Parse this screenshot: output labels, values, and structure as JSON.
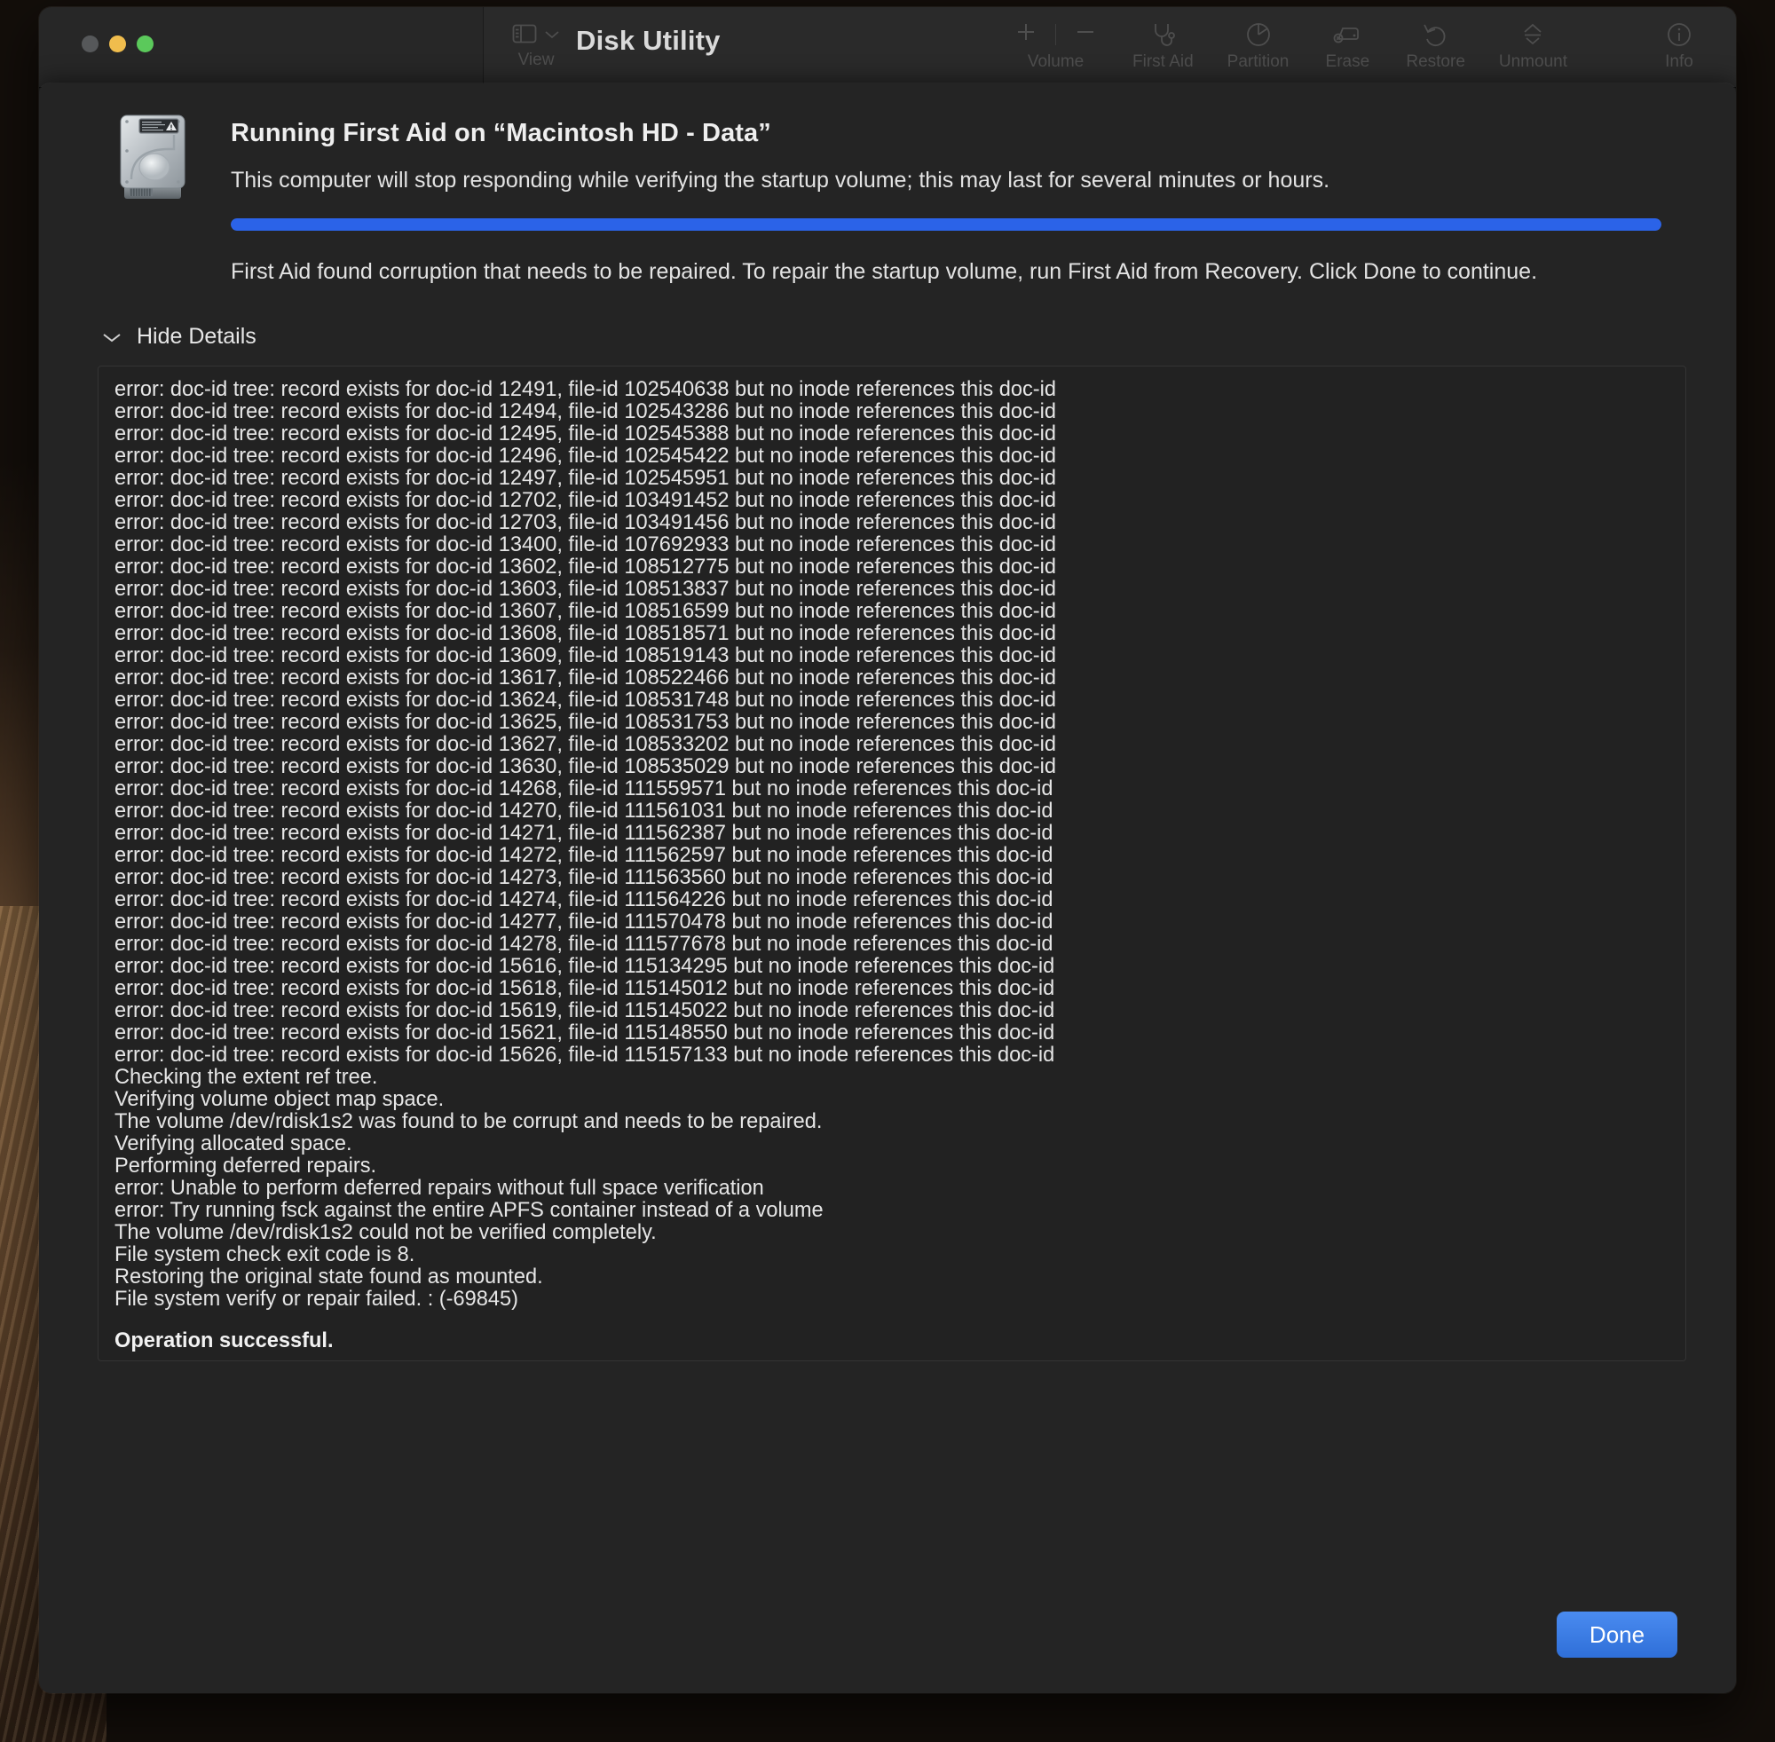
{
  "window": {
    "app_title": "Disk Utility",
    "traffic_lights": [
      "close-button",
      "minimize-button",
      "zoom-button"
    ],
    "sidebar_toggle_label": "View",
    "toolbar": [
      {
        "icon": "plus-icon",
        "label": ""
      },
      {
        "icon": "minus-icon",
        "label": "Volume"
      },
      {
        "icon": "stethoscope-icon",
        "label": "First Aid"
      },
      {
        "icon": "pie-chart-icon",
        "label": "Partition"
      },
      {
        "icon": "erase-disk-icon",
        "label": "Erase"
      },
      {
        "icon": "undo-arrow-icon",
        "label": "Restore"
      },
      {
        "icon": "eject-icon",
        "label": "Unmount"
      },
      {
        "icon": "info-circle-icon",
        "label": "Info"
      }
    ],
    "toolbar_labels": {
      "volume": "Volume",
      "first_aid": "First Aid",
      "partition": "Partition",
      "erase": "Erase",
      "restore": "Restore",
      "unmount": "Unmount",
      "info": "Info"
    }
  },
  "dialog": {
    "icon": "internal-hard-drive-icon",
    "title": "Running First Aid on “Macintosh HD - Data”",
    "subtitle": "This computer will stop responding while verifying the startup volume; this may last for several minutes or hours.",
    "progress_percent": 100,
    "progress_color": "#2b63e8",
    "status": "First Aid found corruption that needs to be repaired. To repair the startup volume, run First Aid from Recovery. Click Done to continue.",
    "details_toggle_label": "Hide Details",
    "details_toggle_icon": "chevron-down-icon",
    "done_label": "Done",
    "done_color": "#3b7ce4"
  },
  "log": {
    "lines": [
      "error: doc-id tree: record exists for doc-id 12491, file-id 102540638 but no inode references this doc-id",
      "error: doc-id tree: record exists for doc-id 12494, file-id 102543286 but no inode references this doc-id",
      "error: doc-id tree: record exists for doc-id 12495, file-id 102545388 but no inode references this doc-id",
      "error: doc-id tree: record exists for doc-id 12496, file-id 102545422 but no inode references this doc-id",
      "error: doc-id tree: record exists for doc-id 12497, file-id 102545951 but no inode references this doc-id",
      "error: doc-id tree: record exists for doc-id 12702, file-id 103491452 but no inode references this doc-id",
      "error: doc-id tree: record exists for doc-id 12703, file-id 103491456 but no inode references this doc-id",
      "error: doc-id tree: record exists for doc-id 13400, file-id 107692933 but no inode references this doc-id",
      "error: doc-id tree: record exists for doc-id 13602, file-id 108512775 but no inode references this doc-id",
      "error: doc-id tree: record exists for doc-id 13603, file-id 108513837 but no inode references this doc-id",
      "error: doc-id tree: record exists for doc-id 13607, file-id 108516599 but no inode references this doc-id",
      "error: doc-id tree: record exists for doc-id 13608, file-id 108518571 but no inode references this doc-id",
      "error: doc-id tree: record exists for doc-id 13609, file-id 108519143 but no inode references this doc-id",
      "error: doc-id tree: record exists for doc-id 13617, file-id 108522466 but no inode references this doc-id",
      "error: doc-id tree: record exists for doc-id 13624, file-id 108531748 but no inode references this doc-id",
      "error: doc-id tree: record exists for doc-id 13625, file-id 108531753 but no inode references this doc-id",
      "error: doc-id tree: record exists for doc-id 13627, file-id 108533202 but no inode references this doc-id",
      "error: doc-id tree: record exists for doc-id 13630, file-id 108535029 but no inode references this doc-id",
      "error: doc-id tree: record exists for doc-id 14268, file-id 111559571 but no inode references this doc-id",
      "error: doc-id tree: record exists for doc-id 14270, file-id 111561031 but no inode references this doc-id",
      "error: doc-id tree: record exists for doc-id 14271, file-id 111562387 but no inode references this doc-id",
      "error: doc-id tree: record exists for doc-id 14272, file-id 111562597 but no inode references this doc-id",
      "error: doc-id tree: record exists for doc-id 14273, file-id 111563560 but no inode references this doc-id",
      "error: doc-id tree: record exists for doc-id 14274, file-id 111564226 but no inode references this doc-id",
      "error: doc-id tree: record exists for doc-id 14277, file-id 111570478 but no inode references this doc-id",
      "error: doc-id tree: record exists for doc-id 14278, file-id 111577678 but no inode references this doc-id",
      "error: doc-id tree: record exists for doc-id 15616, file-id 115134295 but no inode references this doc-id",
      "error: doc-id tree: record exists for doc-id 15618, file-id 115145012 but no inode references this doc-id",
      "error: doc-id tree: record exists for doc-id 15619, file-id 115145022 but no inode references this doc-id",
      "error: doc-id tree: record exists for doc-id 15621, file-id 115148550 but no inode references this doc-id",
      "error: doc-id tree: record exists for doc-id 15626, file-id 115157133 but no inode references this doc-id",
      "Checking the extent ref tree.",
      "Verifying volume object map space.",
      "The volume /dev/rdisk1s2 was found to be corrupt and needs to be repaired.",
      "Verifying allocated space.",
      "Performing deferred repairs.",
      "error: Unable to perform deferred repairs without full space verification",
      "error: Try running fsck against the entire APFS container instead of a volume",
      "The volume /dev/rdisk1s2 could not be verified completely.",
      "File system check exit code is 8.",
      "Restoring the original state found as mounted.",
      "File system verify or repair failed. : (-69845)"
    ],
    "final_line": "Operation successful."
  }
}
